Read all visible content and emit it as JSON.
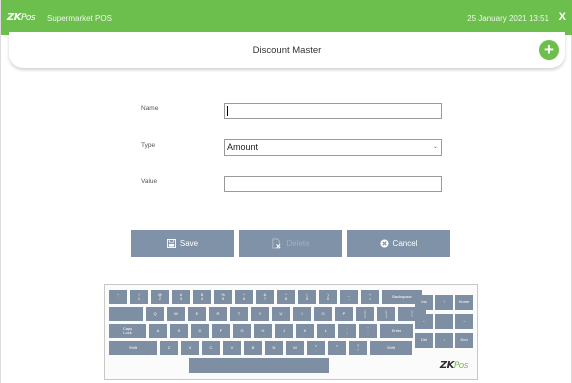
{
  "titlebar": {
    "logo_zk": "ZK",
    "logo_pos": "Pos",
    "app_name": "Supermarket POS",
    "datetime": "25 January 2021 13:51",
    "close_label": "X",
    "accent_color": "#6cbf4d"
  },
  "header": {
    "title": "Discount Master",
    "add_label": "+"
  },
  "form": {
    "name_label": "Name",
    "name_value": "",
    "type_label": "Type",
    "type_value": "Amount",
    "value_label": "Value",
    "value_value": ""
  },
  "actions": {
    "save_label": "Save",
    "delete_label": "Delete",
    "cancel_label": "Cancel",
    "button_color": "#8092a7"
  },
  "keyboard": {
    "logo_zk": "ZK",
    "logo_pos": "Pos",
    "row1": [
      [
        "~",
        "`"
      ],
      [
        "!",
        "1"
      ],
      [
        "@",
        "2"
      ],
      [
        "#",
        "3"
      ],
      [
        "$",
        "4"
      ],
      [
        "%",
        "5"
      ],
      [
        "^",
        "6"
      ],
      [
        "&",
        "7"
      ],
      [
        "*",
        "8"
      ],
      [
        "(",
        "9"
      ],
      [
        ")",
        "0"
      ],
      [
        "_",
        "-"
      ],
      [
        "+",
        "="
      ],
      [
        "Backspace",
        ""
      ]
    ],
    "row2": [
      "Q",
      "W",
      "E",
      "R",
      "T",
      "Y",
      "U",
      "I",
      "O",
      "P",
      [
        "{",
        "["
      ],
      [
        "}",
        "]"
      ],
      [
        "|",
        "\\"
      ]
    ],
    "row3": [
      [
        "Caps",
        "Lock"
      ],
      "A",
      "S",
      "D",
      "F",
      "G",
      "H",
      "J",
      "K",
      "L",
      [
        ":",
        ";"
      ],
      [
        "\"",
        "'"
      ],
      [
        "Enter",
        ""
      ]
    ],
    "row4": [
      "Shift",
      "Z",
      "X",
      "C",
      "V",
      "B",
      "N",
      "M",
      [
        "<",
        ","
      ],
      [
        ">",
        "."
      ],
      [
        "?",
        "/"
      ],
      "Shift"
    ],
    "nav": [
      "Ins",
      "↑",
      "Home",
      "←",
      "",
      "→",
      "Del",
      "↓",
      "End"
    ]
  }
}
